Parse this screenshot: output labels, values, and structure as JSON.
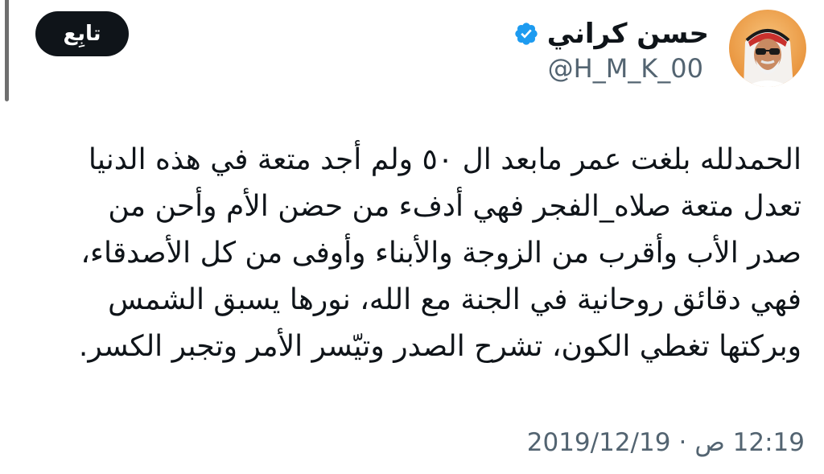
{
  "author": {
    "display_name": "حسن كراني",
    "handle": "@H_M_K_00",
    "verified_icon": "verified-badge-icon",
    "avatar_icon": "profile-avatar"
  },
  "follow_button": {
    "label": "تابِع"
  },
  "tweet": {
    "lines": [
      "الحمدلله بلغت عمر مابعد ال ٥٠ ولم أجد متعة في هذه الدنيا",
      "تعدل متعة صلاه_الفجر فهي أدفء من حضن الأم وأحن من",
      "صدر الأب وأقرب من الزوجة والأبناء وأوفى من كل الأصدقاء،",
      "فهي دقائق روحانية في الجنة مع الله، نورها يسبق الشمس",
      "وبركتها تغطي الكون، تشرح الصدر وتيّسر الأمر وتجبر الكسر."
    ]
  },
  "meta": {
    "time": "12:19 ص",
    "separator": "·",
    "date": "2019/12/19"
  },
  "colors": {
    "text_primary": "#0f1419",
    "text_secondary": "#536471",
    "verified_blue": "#1d9bf0",
    "button_bg": "#0f1419",
    "avatar_bg": "#f0a24a"
  }
}
